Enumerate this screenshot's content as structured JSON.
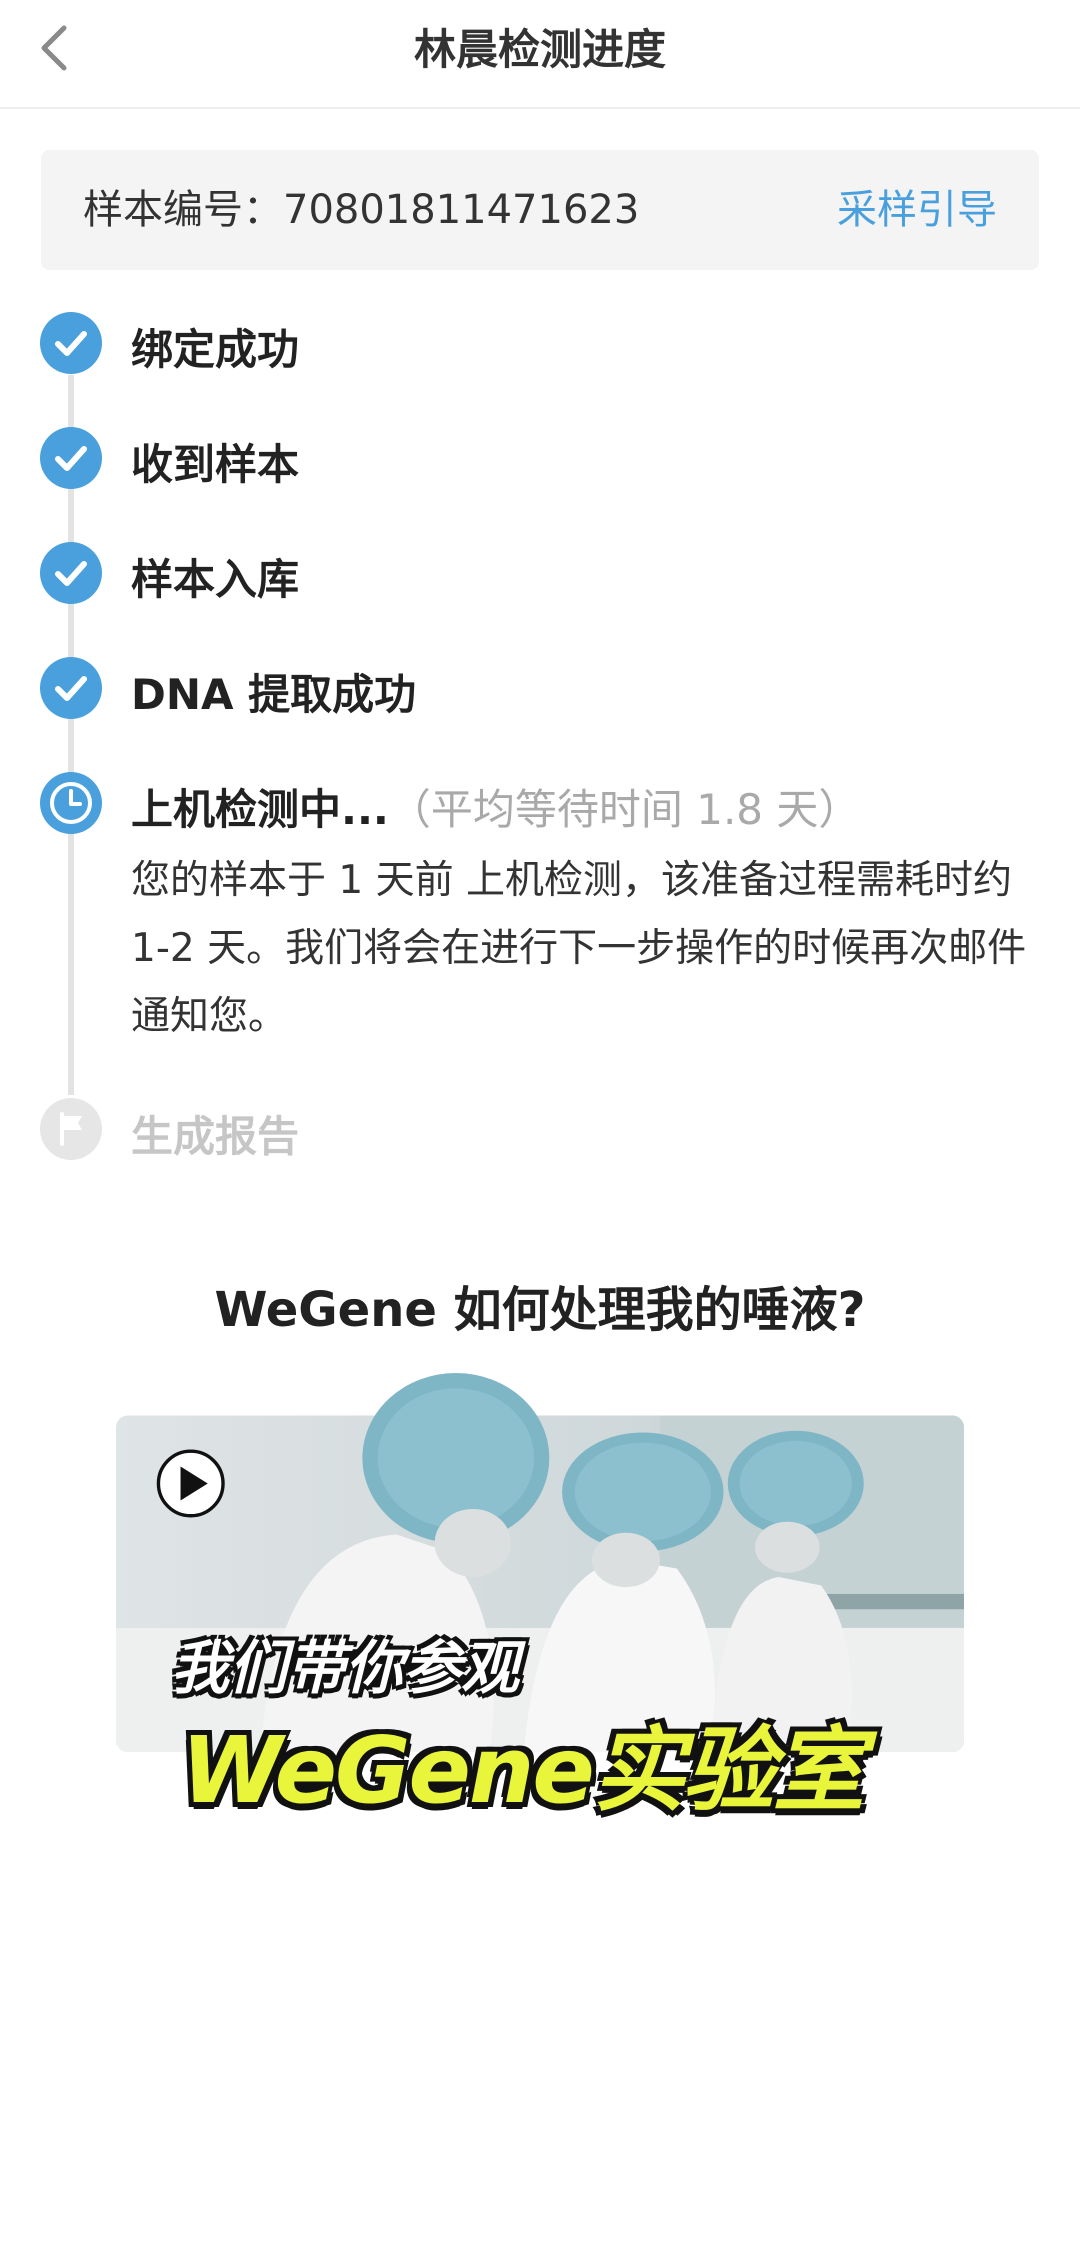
{
  "header": {
    "title": "林晨检测进度",
    "back_icon": "chevron-left-icon"
  },
  "sample": {
    "label": "样本编号：70801811471623",
    "guide_link": "采样引导"
  },
  "steps": [
    {
      "label": "绑定成功",
      "status": "done",
      "icon": "check-circle-icon"
    },
    {
      "label": "收到样本",
      "status": "done",
      "icon": "check-circle-icon"
    },
    {
      "label": "样本入库",
      "status": "done",
      "icon": "check-circle-icon"
    },
    {
      "label": "DNA 提取成功",
      "status": "done",
      "icon": "check-circle-icon"
    },
    {
      "label": "上机检测中...",
      "wait_note": "（平均等待时间 1.8 天）",
      "status": "in-progress",
      "icon": "clock-icon",
      "description": "您的样本于 1 天前 上机检测，该准备过程需耗时约 1-2 天。我们将会在进行下一步操作的时候再次邮件通知您。"
    },
    {
      "label": "生成报告",
      "status": "pending",
      "icon": "flag-icon"
    }
  ],
  "video": {
    "section_title": "WeGene 如何处理我的唾液?",
    "caption_line1": "我们带你参观",
    "caption_line2": "WeGene实验室",
    "play_icon": "play-icon"
  },
  "colors": {
    "accent": "#4aa0dc",
    "pending": "#e6e6e6",
    "caption_yellow": "#e8f53a"
  }
}
